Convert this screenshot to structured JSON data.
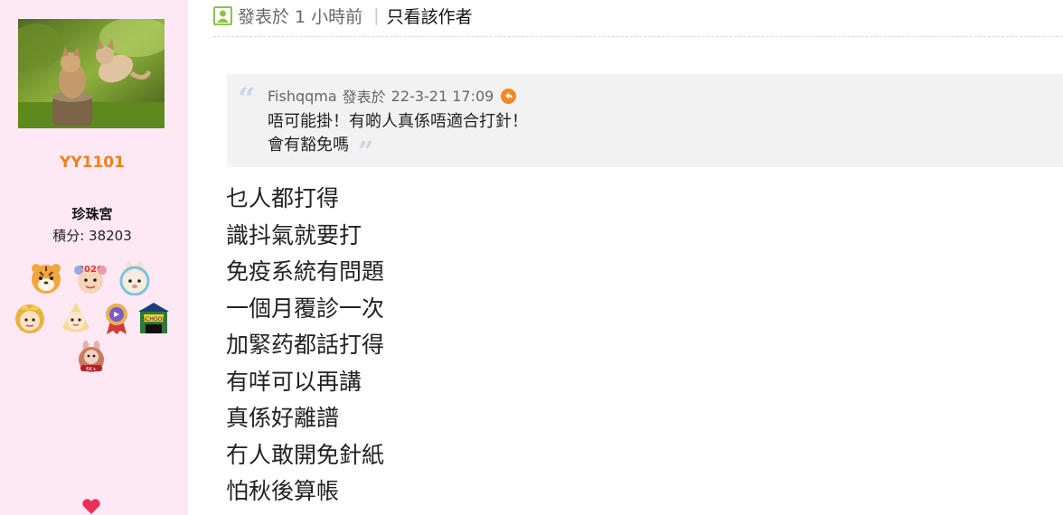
{
  "sidebar": {
    "username": "YY1101",
    "group": "珍珠宮",
    "points": "積分: 38203",
    "medals": [
      "tiger-medal",
      "2020-medal",
      "rabbit-medal",
      "crown-boy-medal",
      "baby-medal",
      "ribbon-medal",
      "school-medal",
      "60k-medal"
    ]
  },
  "post": {
    "posted": "發表於 1 小時前",
    "separator": "|",
    "author_only": "只看該作者",
    "quote": {
      "author": "Fishqqma",
      "posted_label": "發表於",
      "datetime": "22-3-21 17:09",
      "line1": "唔可能掛！有啲人真係唔適合打針！",
      "line2": "會有豁免嗎"
    },
    "lines": [
      "乜人都打得",
      "識抖氣就要打",
      "免疫系統有問題",
      "一個月覆診一次",
      "加緊药都話打得",
      "有咩可以再講",
      "真係好離譜",
      "冇人敢開免針紙",
      "怕秋後算帳"
    ]
  },
  "colors": {
    "sidebar_bg": "#fde8f4",
    "username": "#f07f18",
    "quote_bg": "#f2f2f2",
    "quote_marks": "#c6d8e7",
    "return_icon": "#f08a24"
  }
}
